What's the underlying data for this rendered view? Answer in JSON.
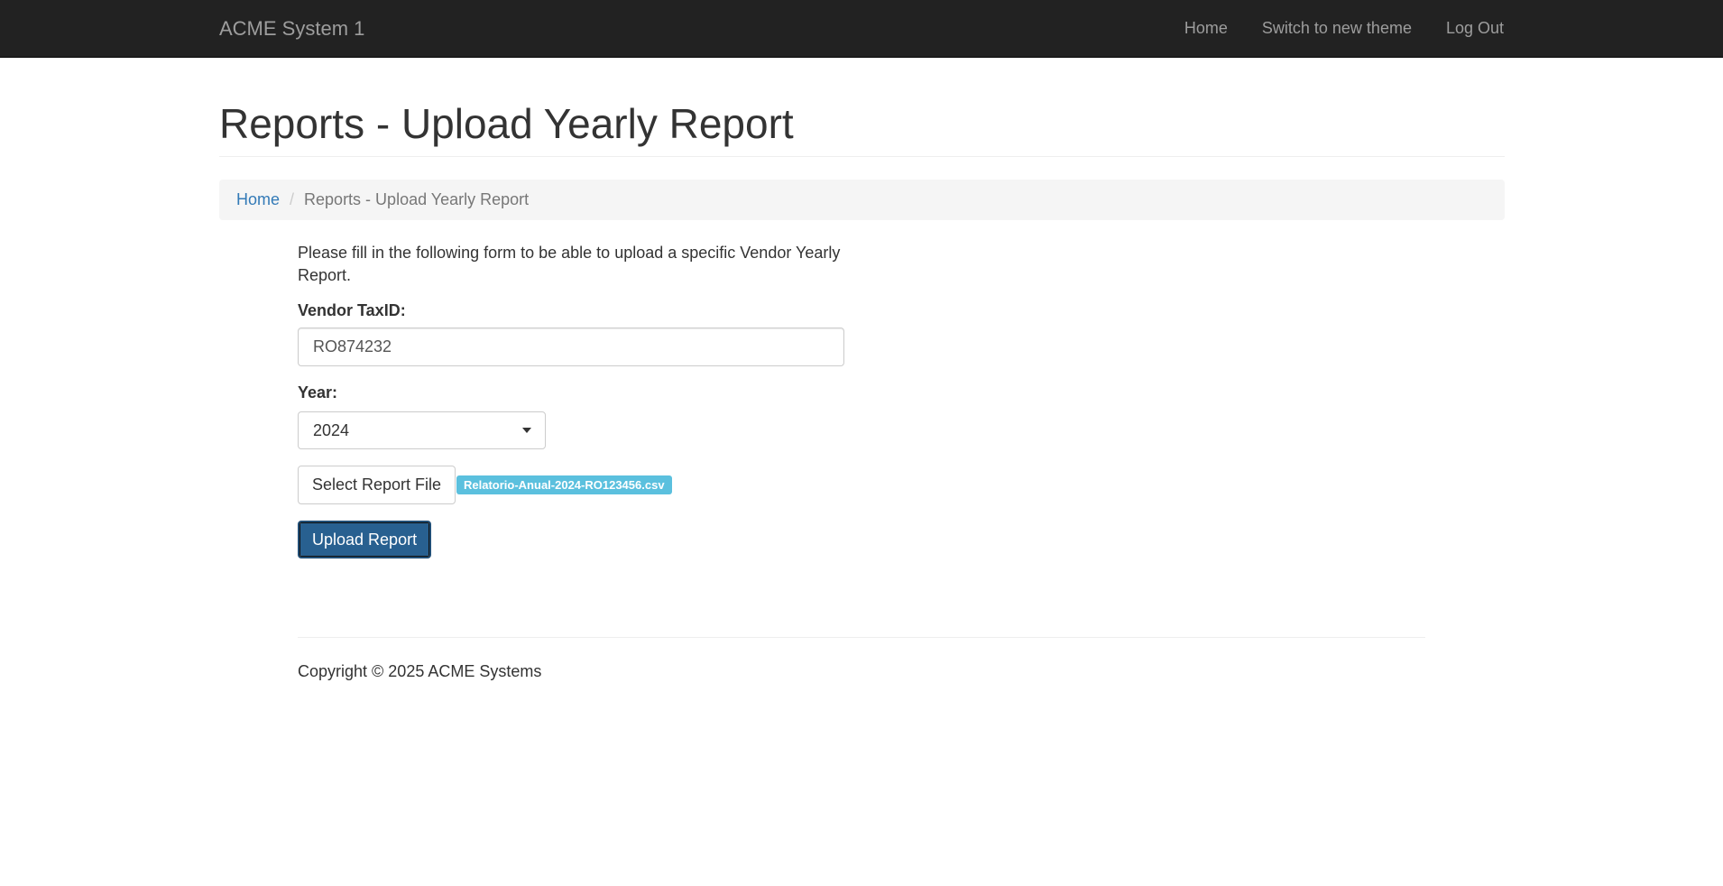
{
  "navbar": {
    "brand": "ACME System 1",
    "links": [
      "Home",
      "Switch to new theme",
      "Log Out"
    ],
    "background": "#222222",
    "link_color": "#9d9d9d"
  },
  "page": {
    "title": "Reports - Upload Yearly Report"
  },
  "breadcrumb": {
    "home": "Home",
    "separator": "/",
    "current": "Reports - Upload Yearly Report"
  },
  "form": {
    "intro": "Please fill in the following form to be able to upload a specific Vendor Yearly Report.",
    "vendor_taxid_label": "Vendor TaxID:",
    "vendor_taxid_value": "RO874232",
    "year_label": "Year:",
    "year_value": "2024",
    "select_file_label": "Select Report File",
    "selected_file_name": "Relatorio-Anual-2024-RO123456.csv",
    "upload_label": "Upload Report",
    "primary_color": "#286090",
    "badge_color": "#5bc0de"
  },
  "footer": {
    "copyright": "Copyright © 2025 ACME Systems"
  }
}
